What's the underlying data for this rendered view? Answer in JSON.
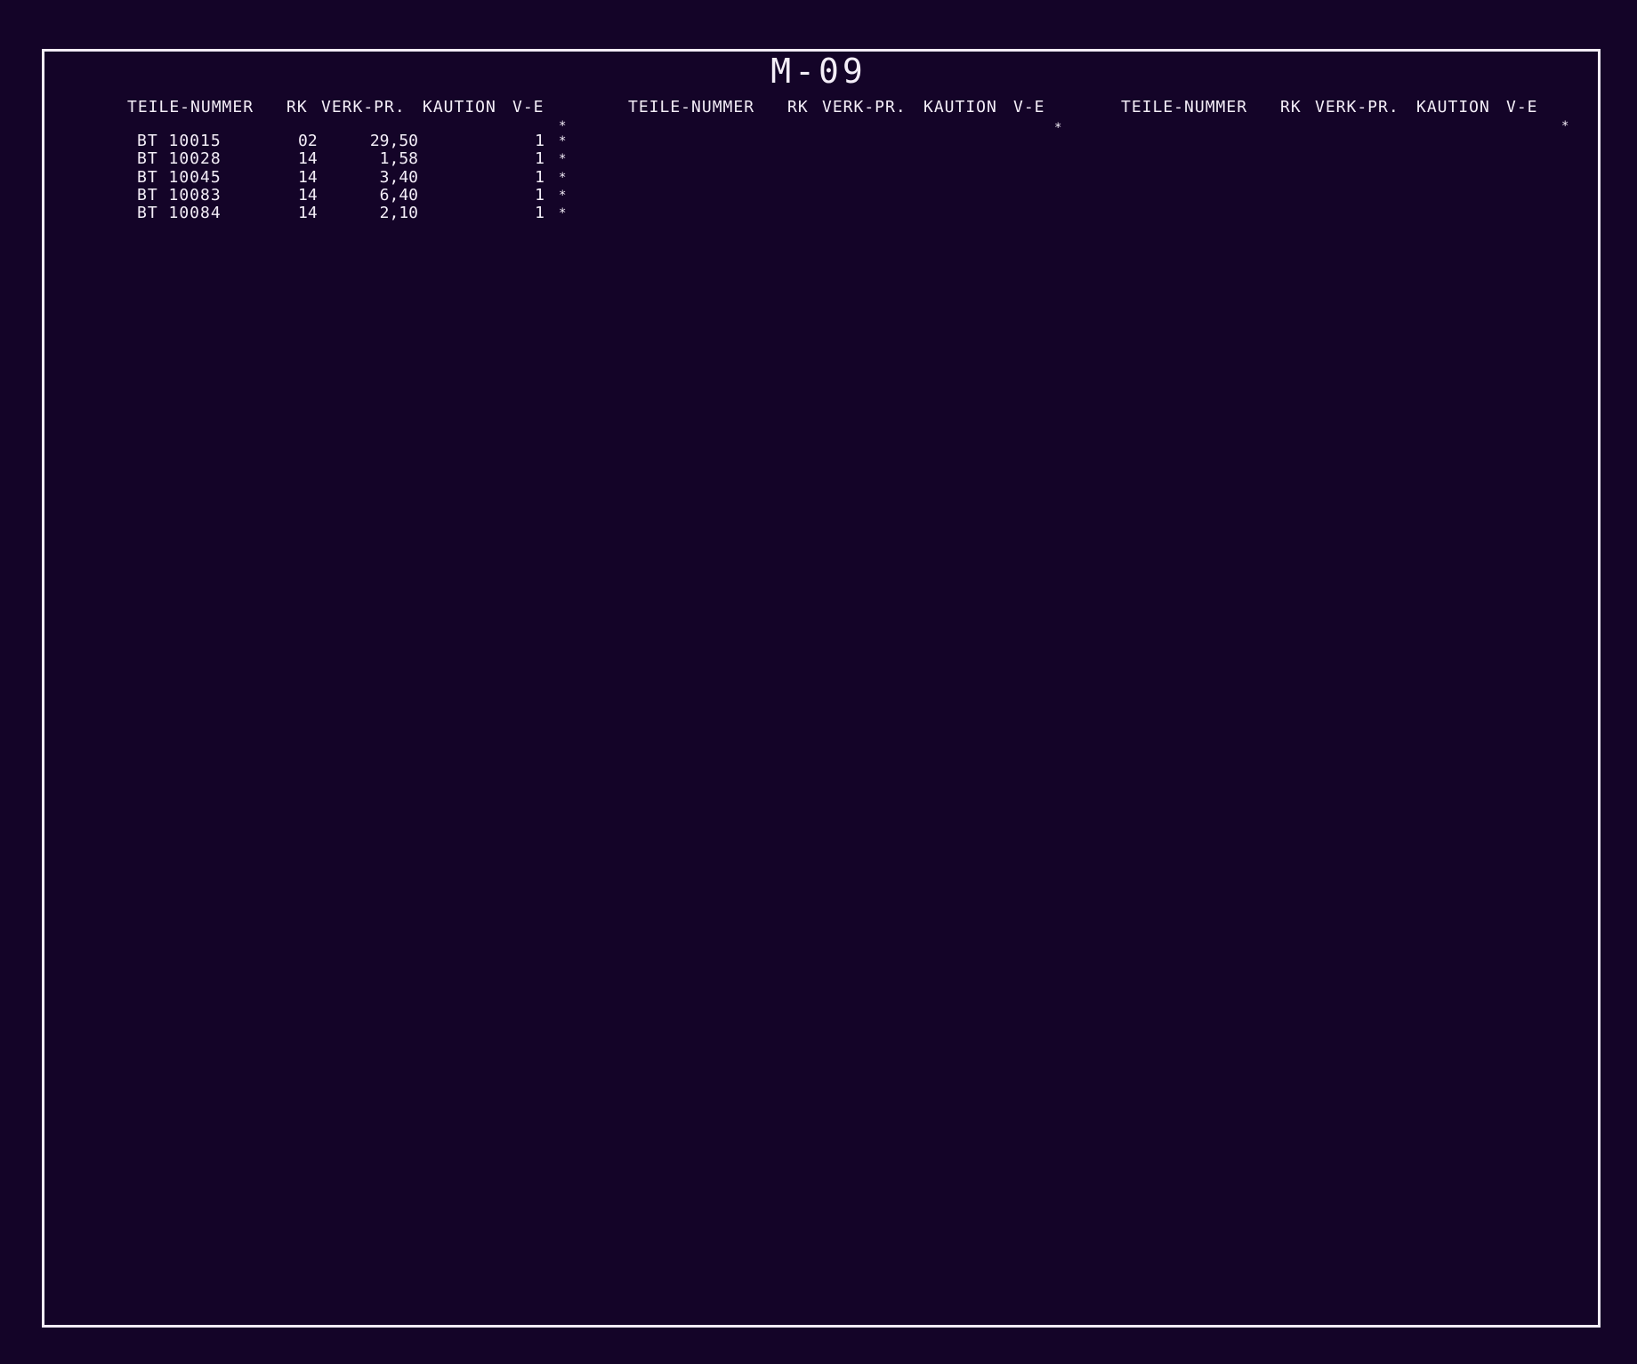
{
  "sheet": {
    "title": "M-09"
  },
  "columns": [
    {
      "headers": {
        "part_number": "TEILE-NUMMER",
        "rk": "RK",
        "sale_price": "VERK-PR.",
        "deposit": "KAUTION",
        "unit": "V-E"
      },
      "header_marker": "*",
      "rows": [
        {
          "part": "BT 10015",
          "rk": "02",
          "price": "29,50",
          "deposit": "",
          "ve": "1",
          "marker": "*"
        },
        {
          "part": "BT 10028",
          "rk": "14",
          "price": "1,58",
          "deposit": "",
          "ve": "1",
          "marker": "*"
        },
        {
          "part": "BT 10045",
          "rk": "14",
          "price": "3,40",
          "deposit": "",
          "ve": "1",
          "marker": "*"
        },
        {
          "part": "BT 10083",
          "rk": "14",
          "price": "6,40",
          "deposit": "",
          "ve": "1",
          "marker": "*"
        },
        {
          "part": "BT 10084",
          "rk": "14",
          "price": "2,10",
          "deposit": "",
          "ve": "1",
          "marker": "*"
        }
      ]
    },
    {
      "headers": {
        "part_number": "TEILE-NUMMER",
        "rk": "RK",
        "sale_price": "VERK-PR.",
        "deposit": "KAUTION",
        "unit": "V-E"
      },
      "header_marker": "*",
      "rows": []
    },
    {
      "headers": {
        "part_number": "TEILE-NUMMER",
        "rk": "RK",
        "sale_price": "VERK-PR.",
        "deposit": "KAUTION",
        "unit": "V-E"
      },
      "header_marker": "*",
      "rows": []
    }
  ]
}
